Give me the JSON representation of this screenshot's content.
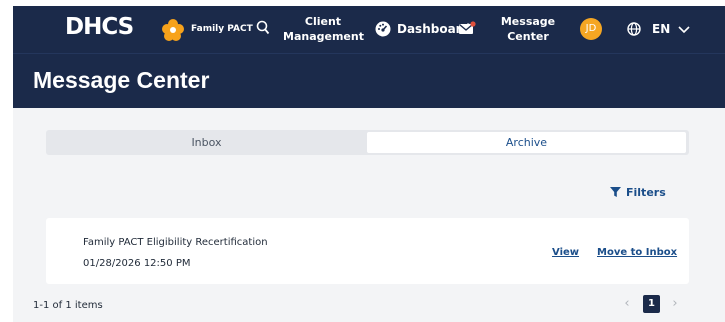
{
  "nav": {
    "logo": "DHCS",
    "family_pact": "Family PACT",
    "client_management_line1": "Client",
    "client_management_line2": "Management",
    "dashboard": "Dashboard",
    "message_center_line1": "Message",
    "message_center_line2": "Center",
    "avatar_initials": "JD",
    "language": "EN"
  },
  "page": {
    "title": "Message Center"
  },
  "tabs": [
    {
      "label": "Inbox",
      "selected": false
    },
    {
      "label": "Archive",
      "selected": true
    }
  ],
  "filters_label": "Filters",
  "messages": [
    {
      "subject": "Family PACT Eligibility Recertification",
      "date": "01/28/2026 12:50 PM",
      "view_label": "View",
      "move_label": "Move to Inbox"
    }
  ],
  "pagination": {
    "range_text": "1-1 of 1 items",
    "current_page": "1",
    "prev_symbol": "‹",
    "next_symbol": "›"
  },
  "colors": {
    "nav_bg": "#1b2a4a",
    "accent_link": "#1b4e8a",
    "avatar": "#f5a623",
    "content_bg": "#f3f4f6"
  }
}
